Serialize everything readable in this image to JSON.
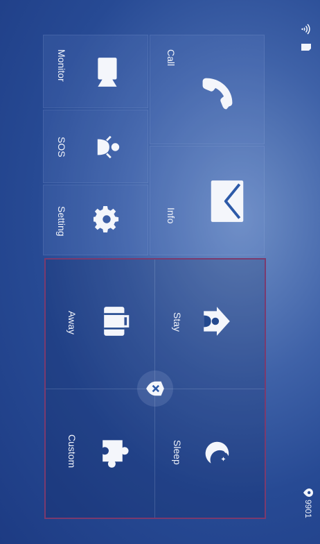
{
  "status": {
    "room_number": "9901",
    "icons": [
      "location-pin-icon",
      "wifi-icon",
      "sim-card-icon"
    ]
  },
  "tiles": {
    "call": {
      "label": "Call",
      "icon": "phone-icon"
    },
    "info": {
      "label": "Info",
      "icon": "envelope-icon"
    },
    "monitor": {
      "label": "Monitor",
      "icon": "camera-icon"
    },
    "sos": {
      "label": "SOS",
      "icon": "sos-person-icon"
    },
    "setting": {
      "label": "Setting",
      "icon": "gear-icon"
    }
  },
  "arm_modes": {
    "status_icon": "disarmed-shield-icon",
    "modes": [
      {
        "label": "Stay",
        "icon": "home-person-icon"
      },
      {
        "label": "Away",
        "icon": "suitcase-icon"
      },
      {
        "label": "Sleep",
        "icon": "moon-icon"
      },
      {
        "label": "Custom",
        "icon": "puzzle-icon"
      }
    ]
  },
  "colors": {
    "accent_border": "#7b3a6d",
    "background": "#1d3b83"
  }
}
